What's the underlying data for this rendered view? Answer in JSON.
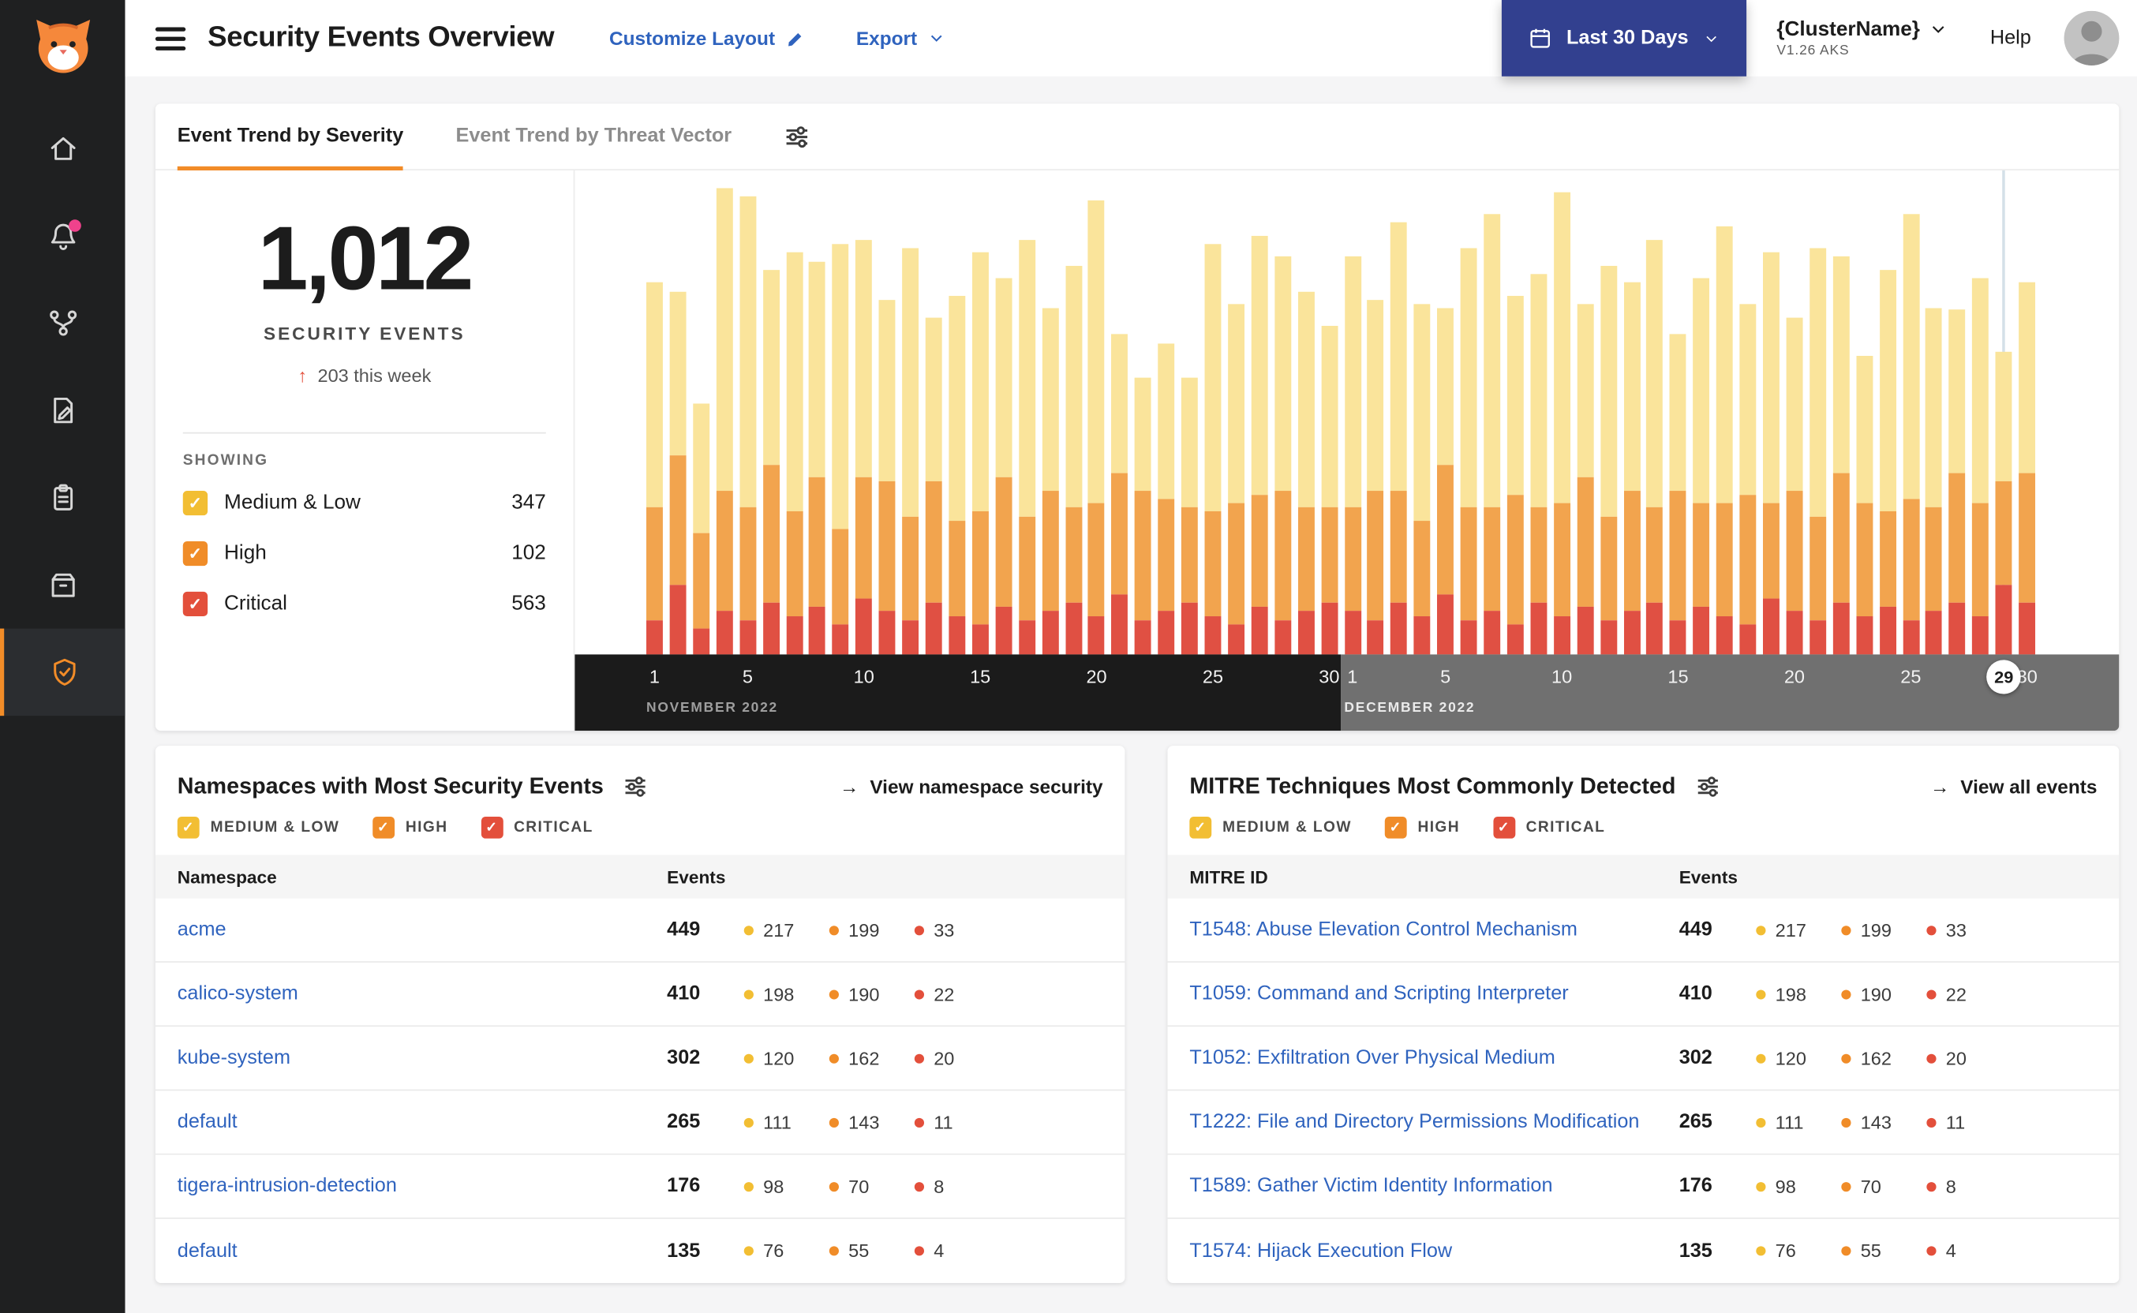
{
  "icons": {
    "check": "✓",
    "arrow_right": "→",
    "arrow_up": "↑"
  },
  "colors": {
    "medium_low": "#F2BE33",
    "high": "#F08C28",
    "critical": "#E34F3B",
    "bar_medium_low": "#FAE49B",
    "bar_high": "#F2A44E",
    "bar_critical": "#E05043",
    "accent_orange": "#F28C28",
    "link_blue": "#2F63BE",
    "date_button_bg": "#32408F",
    "notification_pink": "#F0428C",
    "band_nov": "#1B1B1B",
    "band_dec": "#707070"
  },
  "sidebar": {
    "icons": [
      "calico-cat-logo",
      "home",
      "notifications",
      "service-graph",
      "policies",
      "compliance-reports",
      "image-assurance",
      "threat-defense"
    ]
  },
  "header": {
    "title": "Security Events Overview",
    "customize_layout": "Customize Layout",
    "export": "Export",
    "date_range": "Last 30 Days",
    "cluster_name": "{ClusterName}",
    "cluster_version": "V1.26 AKS",
    "help": "Help"
  },
  "tabs": [
    {
      "label": "Event Trend by Severity",
      "active": true
    },
    {
      "label": "Event Trend by Threat Vector",
      "active": false
    }
  ],
  "summary": {
    "total": "1,012",
    "label": "SECURITY EVENTS",
    "delta": "203 this week",
    "showing_label": "SHOWING",
    "showing": [
      {
        "label": "Medium & Low",
        "value": "347",
        "color_key": "medium_low"
      },
      {
        "label": "High",
        "value": "102",
        "color_key": "high"
      },
      {
        "label": "Critical",
        "value": "563",
        "color_key": "critical"
      }
    ]
  },
  "severity_filters": [
    {
      "label": "MEDIUM & LOW",
      "color_key": "medium_low"
    },
    {
      "label": "HIGH",
      "color_key": "high"
    },
    {
      "label": "CRITICAL",
      "color_key": "critical"
    }
  ],
  "chart_data": {
    "type": "stacked-bar",
    "title": "Event Trend by Severity",
    "ylim": [
      0,
      112
    ],
    "months": [
      {
        "label": "NOVEMBER 2022",
        "days": 30,
        "ticks": [
          1,
          5,
          10,
          15,
          20,
          25,
          30
        ]
      },
      {
        "label": "DECEMBER 2022",
        "days": 30,
        "ticks": [
          1,
          5,
          10,
          15,
          20,
          25,
          30
        ]
      }
    ],
    "highlight": {
      "month_index": 1,
      "day": 29
    },
    "series": [
      {
        "name": "Medium & Low",
        "color_key": "bar_medium_low",
        "values": [
          52,
          38,
          30,
          70,
          72,
          45,
          60,
          50,
          66,
          55,
          42,
          62,
          38,
          52,
          60,
          46,
          64,
          42,
          56,
          70,
          32,
          26,
          36,
          30,
          62,
          46,
          60,
          54,
          50,
          42,
          58,
          44,
          62,
          50,
          36,
          60,
          68,
          46,
          54,
          72,
          40,
          58,
          48,
          62,
          36,
          52,
          64,
          44,
          58,
          40,
          62,
          50,
          34,
          56,
          66,
          46,
          38,
          52,
          30,
          44
        ]
      },
      {
        "name": "High",
        "color_key": "bar_high",
        "values": [
          26,
          30,
          22,
          28,
          26,
          32,
          24,
          30,
          22,
          28,
          30,
          24,
          28,
          22,
          26,
          30,
          24,
          28,
          22,
          26,
          28,
          30,
          26,
          22,
          24,
          28,
          26,
          30,
          24,
          22,
          24,
          30,
          26,
          22,
          30,
          26,
          24,
          30,
          22,
          26,
          30,
          24,
          28,
          22,
          30,
          24,
          26,
          30,
          22,
          28,
          24,
          30,
          26,
          22,
          28,
          24,
          30,
          26,
          24,
          30
        ]
      },
      {
        "name": "Critical",
        "color_key": "bar_critical",
        "values": [
          8,
          16,
          6,
          10,
          8,
          12,
          9,
          11,
          7,
          13,
          10,
          8,
          12,
          9,
          7,
          11,
          8,
          10,
          12,
          9,
          14,
          8,
          10,
          12,
          9,
          7,
          11,
          8,
          10,
          12,
          10,
          8,
          12,
          9,
          14,
          8,
          10,
          7,
          12,
          9,
          11,
          8,
          10,
          12,
          8,
          11,
          9,
          7,
          13,
          10,
          8,
          12,
          9,
          11,
          8,
          10,
          12,
          9,
          16,
          12
        ]
      }
    ]
  },
  "namespaces_card": {
    "title": "Namespaces with Most Security Events",
    "link": "View namespace security",
    "col_name": "Namespace",
    "col_events": "Events",
    "rows": [
      {
        "name": "acme",
        "total": "449",
        "medium_low": "217",
        "high": "199",
        "critical": "33"
      },
      {
        "name": "calico-system",
        "total": "410",
        "medium_low": "198",
        "high": "190",
        "critical": "22"
      },
      {
        "name": "kube-system",
        "total": "302",
        "medium_low": "120",
        "high": "162",
        "critical": "20"
      },
      {
        "name": "default",
        "total": "265",
        "medium_low": "111",
        "high": "143",
        "critical": "11"
      },
      {
        "name": "tigera-intrusion-detection",
        "total": "176",
        "medium_low": "98",
        "high": "70",
        "critical": "8"
      },
      {
        "name": "default",
        "total": "135",
        "medium_low": "76",
        "high": "55",
        "critical": "4"
      }
    ]
  },
  "mitre_card": {
    "title": "MITRE Techniques Most Commonly Detected",
    "link": "View all events",
    "col_name": "MITRE ID",
    "col_events": "Events",
    "rows": [
      {
        "name": "T1548: Abuse Elevation Control Mechanism",
        "total": "449",
        "medium_low": "217",
        "high": "199",
        "critical": "33"
      },
      {
        "name": "T1059: Command and Scripting Interpreter",
        "total": "410",
        "medium_low": "198",
        "high": "190",
        "critical": "22"
      },
      {
        "name": "T1052: Exfiltration Over Physical Medium",
        "total": "302",
        "medium_low": "120",
        "high": "162",
        "critical": "20"
      },
      {
        "name": "T1222: File and Directory Permissions Modification",
        "total": "265",
        "medium_low": "111",
        "high": "143",
        "critical": "11"
      },
      {
        "name": "T1589: Gather Victim Identity Information",
        "total": "176",
        "medium_low": "98",
        "high": "70",
        "critical": "8"
      },
      {
        "name": "T1574: Hijack Execution Flow",
        "total": "135",
        "medium_low": "76",
        "high": "55",
        "critical": "4"
      }
    ]
  }
}
